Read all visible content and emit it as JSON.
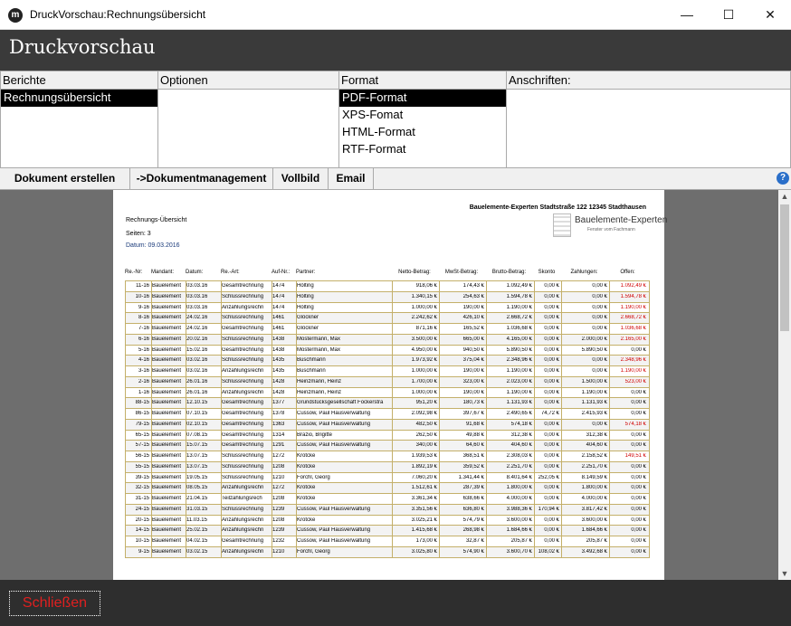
{
  "window": {
    "title": "DruckVorschau:Rechnungsübersicht",
    "minimize": "—",
    "maximize": "☐",
    "close": "✕"
  },
  "header": {
    "title": "Druckvorschau"
  },
  "panels": {
    "berichte": {
      "label": "Berichte",
      "items": [
        "Rechnungsübersicht"
      ]
    },
    "optionen": {
      "label": "Optionen"
    },
    "format": {
      "label": "Format",
      "items": [
        "PDF-Format",
        "XPS-Fomat",
        "HTML-Format",
        "RTF-Format"
      ]
    },
    "anschriften": {
      "label": "Anschriften:"
    }
  },
  "toolbar": {
    "create": "Dokument erstellen",
    "management": "->Dokumentmanagement",
    "fullscreen": "Vollbild",
    "email": "Email",
    "help": "?"
  },
  "report": {
    "company": "Bauelemente-Experten Stadtstraße 122  12345 Stadthausen",
    "logo_name": "Bauelemente-Experten",
    "logo_sub": "Fenster vom Fachmann",
    "title": "Rechnungs-Übersicht",
    "pages": "Seiten: 3",
    "date": "Datum: 09.03.2016",
    "columns": [
      "Re.-Nr:",
      "Mandant:",
      "Datum:",
      "Re.-Art:",
      "Auf-Nr.:",
      "Partner:",
      "Netto-Betrag:",
      "MwSt-Betrag:",
      "Brutto-Betrag:",
      "Skonto",
      "Zahlungen:",
      "Offen:"
    ],
    "rows": [
      [
        "11-16",
        "Bauelement",
        "03.03.16",
        "Gesamtrechnung",
        "1474",
        "Hölting",
        "918,06 €",
        "174,43 €",
        "1.092,49 €",
        "0,00 €",
        "0,00 €",
        "1.092,49 €"
      ],
      [
        "10-16",
        "Bauelement",
        "03.03.16",
        "Schlussrechnung",
        "1474",
        "Hölting",
        "1.340,15 €",
        "254,63 €",
        "1.594,78 €",
        "0,00 €",
        "0,00 €",
        "1.594,78 €"
      ],
      [
        "9-16",
        "Bauelement",
        "03.03.16",
        "Anzahlungsrechn",
        "1474",
        "Hölting",
        "1.000,00 €",
        "190,00 €",
        "1.190,00 €",
        "0,00 €",
        "0,00 €",
        "1.190,00 €"
      ],
      [
        "8-16",
        "Bauelement",
        "24.02.16",
        "Schlussrechnung",
        "1461",
        "Glöckner",
        "2.242,62 €",
        "426,10 €",
        "2.668,72 €",
        "0,00 €",
        "0,00 €",
        "2.668,72 €"
      ],
      [
        "7-16",
        "Bauelement",
        "24.02.16",
        "Gesamtrechnung",
        "1461",
        "Glöckner",
        "871,16 €",
        "165,52 €",
        "1.036,68 €",
        "0,00 €",
        "0,00 €",
        "1.036,68 €"
      ],
      [
        "6-16",
        "Bauelement",
        "20.02.16",
        "Schlussrechnung",
        "1438",
        "Mostermann, Max",
        "3.500,00 €",
        "665,00 €",
        "4.165,00 €",
        "0,00 €",
        "2.000,00 €",
        "2.165,00 €"
      ],
      [
        "5-16",
        "Bauelement",
        "15.02.16",
        "Gesamtrechnung",
        "1438",
        "Mostermann, Max",
        "4.950,00 €",
        "940,50 €",
        "5.890,50 €",
        "0,00 €",
        "5.890,50 €",
        "0,00 €"
      ],
      [
        "4-16",
        "Bauelement",
        "03.02.16",
        "Schlussrechnung",
        "1435",
        "Buschmann",
        "1.973,92 €",
        "375,04 €",
        "2.348,96 €",
        "0,00 €",
        "0,00 €",
        "2.348,96 €"
      ],
      [
        "3-16",
        "Bauelement",
        "03.02.16",
        "Anzahlungsrechn",
        "1435",
        "Buschmann",
        "1.000,00 €",
        "190,00 €",
        "1.190,00 €",
        "0,00 €",
        "0,00 €",
        "1.190,00 €"
      ],
      [
        "2-16",
        "Bauelement",
        "26.01.16",
        "Schlussrechnung",
        "1428",
        "Heinzmann, Heinz",
        "1.700,00 €",
        "323,00 €",
        "2.023,00 €",
        "0,00 €",
        "1.500,00 €",
        "523,00 €"
      ],
      [
        "1-16",
        "Bauelement",
        "26.01.16",
        "Anzahlungsrechn",
        "1428",
        "Heinzmann, Heinz",
        "1.000,00 €",
        "190,00 €",
        "1.190,00 €",
        "0,00 €",
        "1.190,00 €",
        "0,00 €"
      ],
      [
        "88-15",
        "Bauelement",
        "12.10.15",
        "Gesamtrechnung",
        "1377",
        "Grundstücksgesellschaft Fockerstra",
        "951,20 €",
        "180,73 €",
        "1.131,93 €",
        "0,00 €",
        "1.131,93 €",
        "0,00 €"
      ],
      [
        "86-15",
        "Bauelement",
        "07.10.15",
        "Gesamtrechnung",
        "1378",
        "Cussow, Paul Hausverwaltung",
        "2.092,98 €",
        "397,67 €",
        "2.490,65 €",
        "74,72 €",
        "2.415,93 €",
        "0,00 €"
      ],
      [
        "79-15",
        "Bauelement",
        "02.10.15",
        "Gesamtrechnung",
        "1363",
        "Cussow, Paul Hausverwaltung",
        "482,50 €",
        "91,68 €",
        "574,18 €",
        "0,00 €",
        "0,00 €",
        "574,18 €"
      ],
      [
        "65-15",
        "Bauelement",
        "07.08.15",
        "Gesamtrechnung",
        "1314",
        "Brazio, Brigitte",
        "262,50 €",
        "49,88 €",
        "312,38 €",
        "0,00 €",
        "312,38 €",
        "0,00 €"
      ],
      [
        "57-15",
        "Bauelement",
        "15.07.15",
        "Gesamtrechnung",
        "1291",
        "Cussow, Paul Hausverwaltung",
        "340,00 €",
        "64,60 €",
        "404,60 €",
        "0,00 €",
        "404,60 €",
        "0,00 €"
      ],
      [
        "56-15",
        "Bauelement",
        "13.07.15",
        "Schlussrechnung",
        "1272",
        "Krotcke",
        "1.939,53 €",
        "368,51 €",
        "2.308,03 €",
        "0,00 €",
        "2.158,52 €",
        "149,51 €"
      ],
      [
        "55-15",
        "Bauelement",
        "13.07.15",
        "Schlussrechnung",
        "1208",
        "Krotcke",
        "1.892,19 €",
        "359,52 €",
        "2.251,70 €",
        "0,00 €",
        "2.251,70 €",
        "0,00 €"
      ],
      [
        "39-15",
        "Bauelement",
        "19.05.15",
        "Schlussrechnung",
        "1210",
        "Forchl, Georg",
        "7.060,20 €",
        "1.341,44 €",
        "8.401,64 €",
        "252,05 €",
        "8.149,59 €",
        "0,00 €"
      ],
      [
        "32-15",
        "Bauelement",
        "08.05.15",
        "Anzahlungsrechn",
        "1272",
        "Krotcke",
        "1.512,61 €",
        "287,39 €",
        "1.800,00 €",
        "0,00 €",
        "1.800,00 €",
        "0,00 €"
      ],
      [
        "31-15",
        "Bauelement",
        "21.04.15",
        "Teilzahlungsrech",
        "1208",
        "Krotcke",
        "3.361,34 €",
        "638,66 €",
        "4.000,00 €",
        "0,00 €",
        "4.000,00 €",
        "0,00 €"
      ],
      [
        "24-15",
        "Bauelement",
        "31.03.15",
        "Schlussrechnung",
        "1239",
        "Cussow, Paul Hausverwaltung",
        "3.351,56 €",
        "636,80 €",
        "3.988,36 €",
        "170,94 €",
        "3.817,42 €",
        "0,00 €"
      ],
      [
        "20-15",
        "Bauelement",
        "11.03.15",
        "Anzahlungsrechn",
        "1208",
        "Krotcke",
        "3.025,21 €",
        "574,79 €",
        "3.600,00 €",
        "0,00 €",
        "3.600,00 €",
        "0,00 €"
      ],
      [
        "14-15",
        "Bauelement",
        "25.02.15",
        "Anzahlungsrechn",
        "1239",
        "Cussow, Paul Hausverwaltung",
        "1.415,68 €",
        "268,98 €",
        "1.684,66 €",
        "0,00 €",
        "1.684,66 €",
        "0,00 €"
      ],
      [
        "10-15",
        "Bauelement",
        "04.02.15",
        "Gesamtrechnung",
        "1232",
        "Cussow, Paul Hausverwaltung",
        "173,00 €",
        "32,87 €",
        "205,87 €",
        "0,00 €",
        "205,87 €",
        "0,00 €"
      ],
      [
        "9-15",
        "Bauelement",
        "03.02.15",
        "Anzahlungsrechn",
        "1210",
        "Forchl, Georg",
        "3.025,80 €",
        "574,90 €",
        "3.600,70 €",
        "108,02 €",
        "3.492,68 €",
        "0,00 €"
      ]
    ]
  },
  "colors": {
    "open_red": "#d00000",
    "header_bg": "#3a3a3a",
    "footer_bg": "#2e2e2e"
  },
  "footer": {
    "close": "Schließen"
  }
}
